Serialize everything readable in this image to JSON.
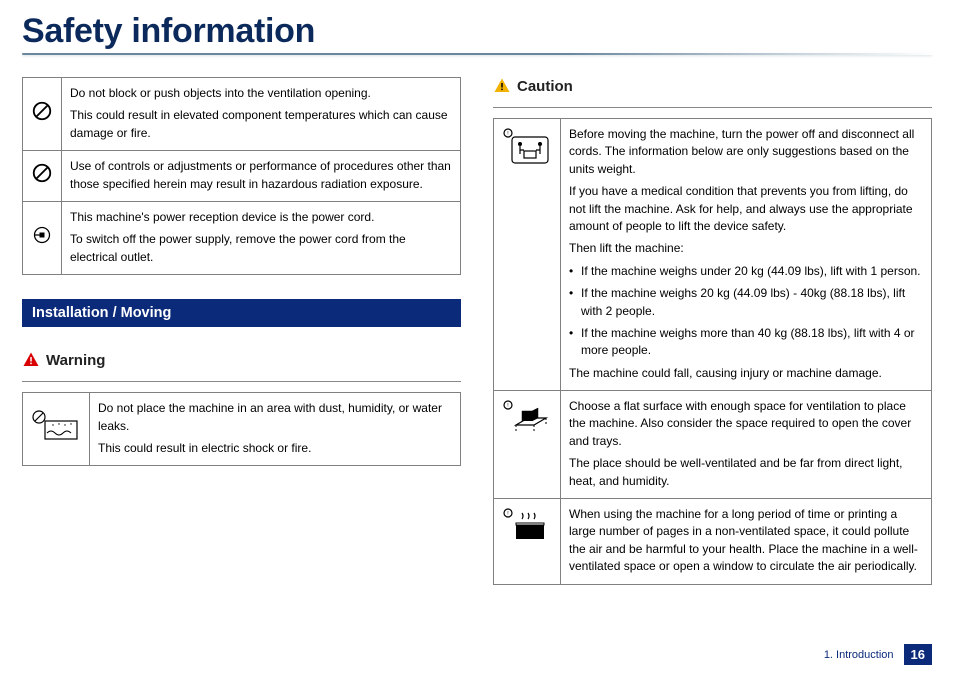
{
  "page": {
    "title": "Safety information",
    "section_bar": "Installation / Moving",
    "warning_label": "Warning",
    "caution_label": "Caution",
    "footer_chapter": "1. Introduction",
    "footer_page": "16"
  },
  "left_top_rows": [
    {
      "icon": "prohibit-icon",
      "lines": [
        "Do not block or push objects into the ventilation opening.",
        "This could result in elevated component temperatures which can cause damage or fire."
      ]
    },
    {
      "icon": "prohibit-icon",
      "lines": [
        "Use of controls or adjustments or performance of procedures other than those specified herein may result in hazardous radiation exposure."
      ]
    },
    {
      "icon": "plug-circle-icon",
      "lines": [
        "This machine's power reception device is the power cord.",
        "To switch off the power supply, remove the power cord from the electrical outlet."
      ]
    }
  ],
  "warning_rows": [
    {
      "icon": "no-water-icon",
      "lines": [
        "Do not place the machine in an area with dust, humidity, or water leaks.",
        "This could result in electric shock or fire."
      ]
    }
  ],
  "caution_rows": [
    {
      "icon": "two-person-lift-icon",
      "intro": "Before moving the machine, turn the power off and disconnect all cords. The information below are only suggestions based on the units weight.",
      "medical": "If you have a medical condition that prevents you from lifting, do not lift the machine. Ask for help, and always use the appropriate amount of people to lift the device safety.",
      "then": "Then lift the machine:",
      "bullets": [
        "If the machine weighs under 20 kg (44.09 lbs), lift with 1 person.",
        "If the machine weighs 20 kg (44.09 lbs) - 40kg (88.18 lbs), lift with 2 people.",
        "If the machine weighs more than 40 kg (88.18 lbs), lift with 4 or more people."
      ],
      "outro": "The machine could fall, causing injury or machine damage."
    },
    {
      "icon": "flat-surface-icon",
      "lines": [
        "Choose a flat surface with enough space for ventilation to place the machine. Also consider the space required to open the cover and trays.",
        "The place should be well-ventilated and be far from direct light, heat, and humidity."
      ]
    },
    {
      "icon": "ventilation-icon",
      "lines": [
        "When using the machine for a long period of time or printing a large number of pages in a non-ventilated space, it could pollute the air and be harmful to your health. Place the machine  in a well-ventilated space or open a window to circulate the air periodically."
      ]
    }
  ]
}
